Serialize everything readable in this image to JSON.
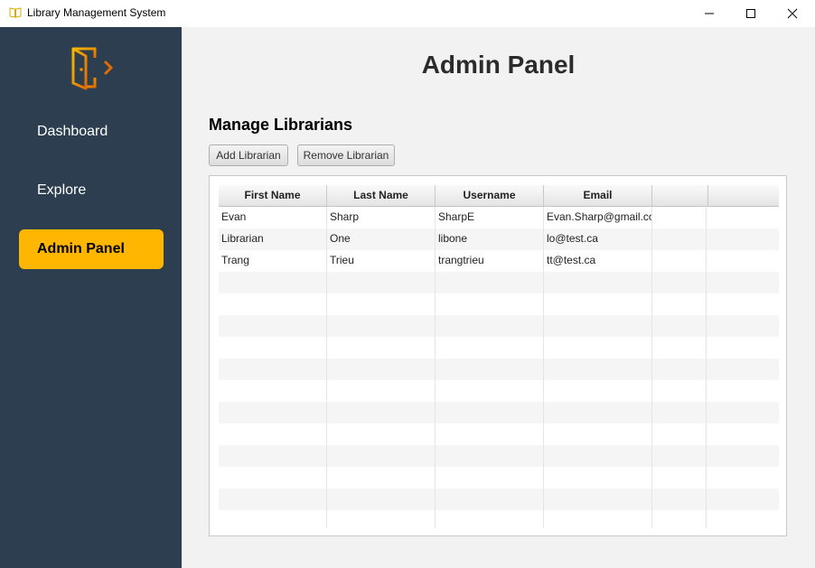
{
  "window": {
    "title": "Library Management System"
  },
  "sidebar": {
    "items": [
      {
        "label": "Dashboard"
      },
      {
        "label": "Explore"
      },
      {
        "label": "Admin Panel",
        "active": true
      }
    ],
    "active_color": "#ffb600",
    "background": "#2c3e50"
  },
  "main": {
    "title": "Admin Panel",
    "section_title": "Manage Librarians",
    "buttons": {
      "add": "Add Librarian",
      "remove": "Remove Librarian"
    },
    "table": {
      "columns": [
        "First Name",
        "Last Name",
        "Username",
        "Email",
        ""
      ],
      "rows": [
        {
          "first": "Evan",
          "last": "Sharp",
          "username": "SharpE",
          "email": "Evan.Sharp@gmail.com"
        },
        {
          "first": "Librarian",
          "last": "One",
          "username": "libone",
          "email": "lo@test.ca"
        },
        {
          "first": "Trang",
          "last": "Trieu",
          "username": "trangtrieu",
          "email": "tt@test.ca"
        }
      ]
    }
  }
}
